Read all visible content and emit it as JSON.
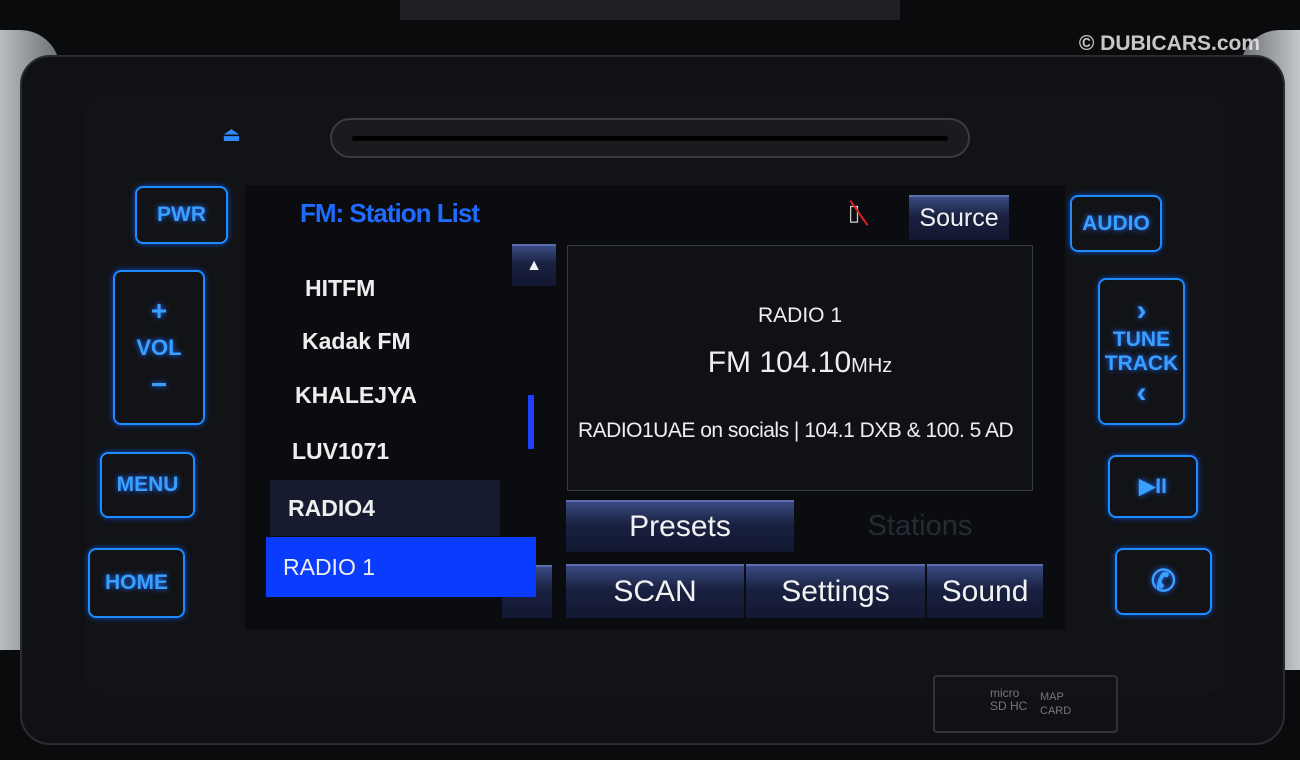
{
  "watermark": "© DUBICARS.com",
  "hard_buttons": {
    "power": "PWR",
    "vol_plus": "+",
    "vol": "VOL",
    "vol_minus": "−",
    "menu": "MENU",
    "home": "HOME",
    "audio": "AUDIO",
    "tune_next": "›",
    "tune": "TUNE",
    "track": "TRACK",
    "tune_prev": "‹",
    "play_pause": "▶II",
    "phone": "✆",
    "eject": "⏏"
  },
  "screen": {
    "title": "FM: Station List",
    "source_label": "Source",
    "phone_status_icon": "phone-disconnected-icon",
    "stations": [
      "HITFM",
      "Kadak FM",
      "KHALEJYA",
      "LUV1071",
      "RADIO4",
      "RADIO 1"
    ],
    "selected_station": "RADIO 1",
    "scroll_up": "▲",
    "scroll_down": "▼",
    "now_playing": {
      "name": "RADIO 1",
      "band": "FM",
      "frequency": "104.10",
      "unit": "MHz",
      "radio_text": "RADIO1UAE on socials | 104.1 DXB & 100. 5 AD"
    },
    "tabs": {
      "presets": "Presets",
      "stations": "Stations"
    },
    "bottom": {
      "scan": "SCAN",
      "settings": "Settings",
      "sound": "Sound"
    },
    "accent": "#1f6bff"
  },
  "sd_slot": {
    "logo": "micro SD HC",
    "label1": "MAP",
    "label2": "CARD"
  }
}
